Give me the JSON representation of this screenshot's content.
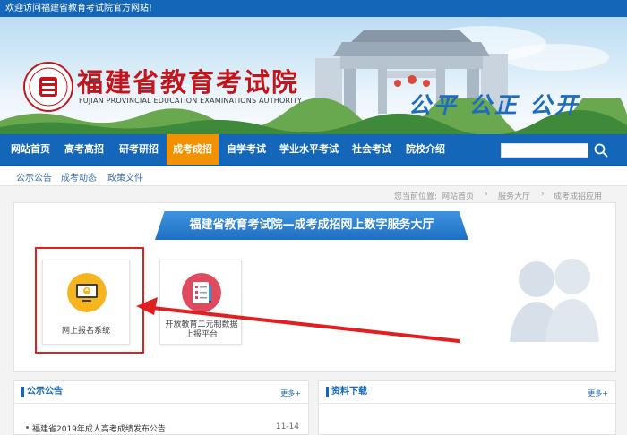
{
  "topbar": {
    "welcome": "欢迎访问福建省教育考试院官方网站!"
  },
  "header": {
    "title": "福建省教育考试院",
    "subtitle": "FUJIAN PROVINCIAL EDUCATION EXAMINATIONS AUTHORITY",
    "slogan": "公平 公正 公开",
    "brand_color": "#c3151b"
  },
  "nav": {
    "items": [
      {
        "label": "网站首页"
      },
      {
        "label": "高考高招"
      },
      {
        "label": "研考研招"
      },
      {
        "label": "成考成招",
        "active": true
      },
      {
        "label": "自学考试"
      },
      {
        "label": "学业水平考试"
      },
      {
        "label": "社会考试"
      },
      {
        "label": "院校介绍"
      }
    ],
    "search_placeholder": "",
    "bar_color": "#1467b8",
    "active_color": "#f29200"
  },
  "subnav": {
    "items": [
      {
        "label": "公示公告"
      },
      {
        "label": "成考动态"
      },
      {
        "label": "政策文件"
      }
    ]
  },
  "breadcrumb": {
    "prefix": "您当前位置:",
    "items": [
      {
        "label": "网站首页"
      },
      {
        "label": "服务大厅"
      },
      {
        "label": "成考成招应用"
      }
    ]
  },
  "hall": {
    "title": "福建省教育考试院—成考成招网上数字服务大厅",
    "cards": [
      {
        "label": "网上报名系统",
        "icon": "monitor-upload-icon",
        "color": "#f6b51e"
      },
      {
        "label": "开放教育二元制数据上报平台",
        "icon": "checklist-pen-icon",
        "color": "#e04a5f"
      }
    ]
  },
  "panels": {
    "notices": {
      "title": "公示公告",
      "more": "更多+",
      "items": [
        {
          "title": "福建省2019年成人高考成绩发布公告",
          "date": "11-14"
        }
      ]
    },
    "downloads": {
      "title": "资料下载",
      "more": "更多+"
    }
  }
}
